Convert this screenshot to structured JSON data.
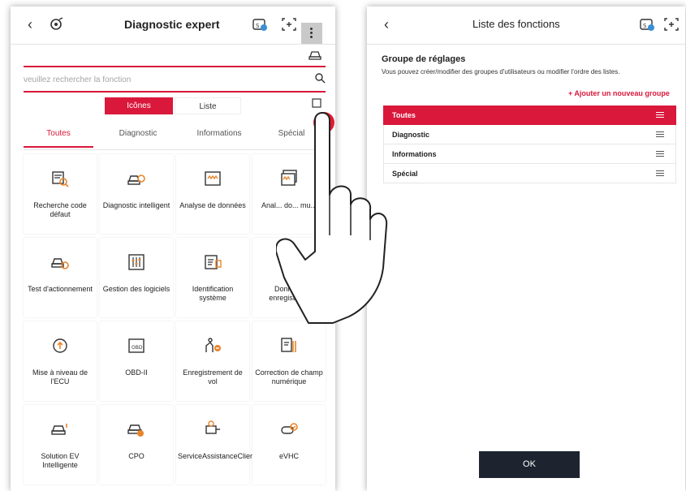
{
  "left_screen": {
    "title": "Diagnostic expert",
    "search": {
      "placeholder": "veuillez rechercher la fonction"
    },
    "view_toggle": {
      "icons_label": "Icônes",
      "list_label": "Liste"
    },
    "tabs": [
      {
        "label": "Toutes"
      },
      {
        "label": "Diagnostic"
      },
      {
        "label": "Informations"
      },
      {
        "label": "Spécial"
      }
    ],
    "functions": [
      {
        "label": "Recherche code défaut",
        "icon": "search-code-icon"
      },
      {
        "label": "Diagnostic intelligent",
        "icon": "smart-diagnostic-icon"
      },
      {
        "label": "Analyse de données",
        "icon": "data-analysis-icon"
      },
      {
        "label": "Anal... do... mu...",
        "icon": "multi-data-analysis-icon"
      },
      {
        "label": "Test d'actionnement",
        "icon": "actuation-test-icon"
      },
      {
        "label": "Gestion des logiciels",
        "icon": "software-management-icon"
      },
      {
        "label": "Identification système",
        "icon": "system-id-icon"
      },
      {
        "label": "Données enregistrées",
        "icon": "recorded-data-icon"
      },
      {
        "label": "Mise à niveau de l'ECU",
        "icon": "ecu-upgrade-icon"
      },
      {
        "label": "OBD-II",
        "icon": "obd-icon"
      },
      {
        "label": "Enregistrement de vol",
        "icon": "flight-record-icon"
      },
      {
        "label": "Correction de champ numérique",
        "icon": "field-correction-icon"
      },
      {
        "label": "Solution EV Intelligente",
        "icon": "ev-solution-icon"
      },
      {
        "label": "CPO",
        "icon": "cpo-icon"
      },
      {
        "label": "ServiceAssistanceClientèle",
        "icon": "customer-service-icon"
      },
      {
        "label": "eVHC",
        "icon": "evhc-icon"
      }
    ]
  },
  "right_screen": {
    "title": "Liste des fonctions",
    "section_title": "Groupe de réglages",
    "section_desc": "Vous pouvez créer/modifier des groupes d'utilisateurs ou modifier l'ordre des listes.",
    "add_group": "+ Ajouter un nouveau groupe",
    "groups": [
      {
        "label": "Toutes",
        "active": true
      },
      {
        "label": "Diagnostic",
        "active": false
      },
      {
        "label": "Informations",
        "active": false
      },
      {
        "label": "Spécial",
        "active": false
      }
    ],
    "ok_label": "OK"
  },
  "colors": {
    "accent": "#d9183b",
    "dark_button": "#1d2430",
    "icon_orange": "#e8852a"
  }
}
